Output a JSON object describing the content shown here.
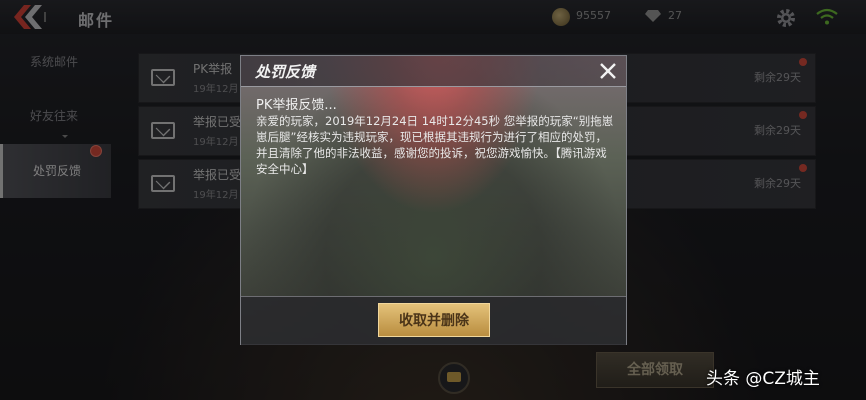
{
  "header": {
    "title": "邮件",
    "gold_amount": "95557",
    "diamond_amount": "27",
    "wifi_color": "#6fbf3a"
  },
  "sidebar": {
    "items": [
      {
        "label": "系统邮件",
        "active": false
      },
      {
        "label": "好友往来",
        "active": false
      },
      {
        "label": "处罚反馈",
        "active": true
      }
    ]
  },
  "mails": [
    {
      "title": "PK举报",
      "date": "19年12月",
      "remain": "剩余29天"
    },
    {
      "title": "举报已受",
      "date": "19年12月",
      "remain": "剩余29天"
    },
    {
      "title": "举报已受",
      "date": "19年12月",
      "remain": "剩余29天"
    }
  ],
  "bottom": {
    "collect_all": "全部领取"
  },
  "dialog": {
    "title": "处罚反馈",
    "subject": "PK举报反馈...",
    "body": "亲爱的玩家，2019年12月24日 14时12分45秒 您举报的玩家“别拖崽崽后腿”经核实为违规玩家，现已根据其违规行为进行了相应的处罚，并且清除了他的非法收益，感谢您的投诉，祝您游戏愉快。【腾讯游戏安全中心】",
    "button": "收取并删除"
  },
  "watermark": "头条 @CZ城主",
  "colors": {
    "accent_gold": "#d9b469",
    "badge_red": "#d64b3c"
  }
}
